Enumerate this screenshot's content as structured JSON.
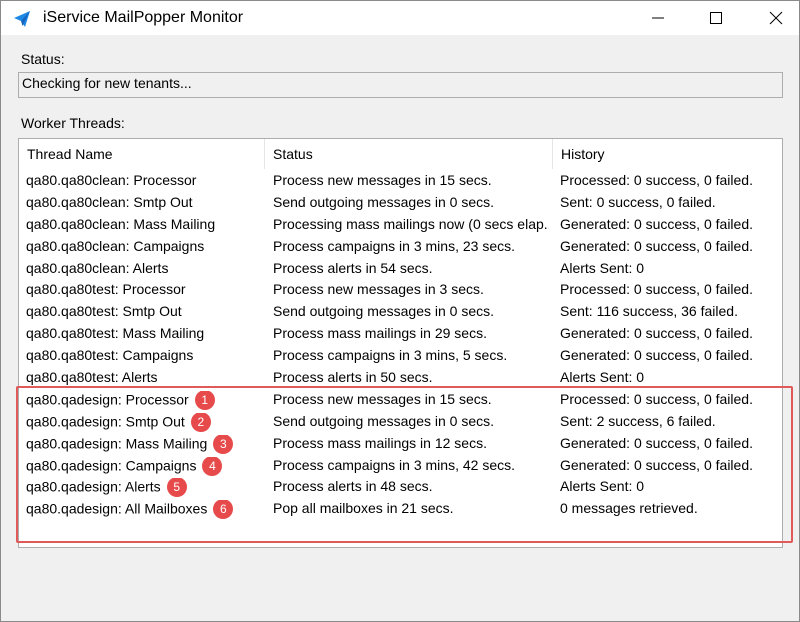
{
  "window": {
    "title": "iService MailPopper Monitor",
    "icon": "paper-plane-icon",
    "controls": [
      "minimize-icon",
      "maximize-icon",
      "close-icon"
    ]
  },
  "status": {
    "label": "Status:",
    "value": "Checking for new tenants..."
  },
  "worker_threads": {
    "label": "Worker Threads:",
    "columns": [
      "Thread Name",
      "Status",
      "History"
    ],
    "rows": [
      {
        "name": "qa80.qa80clean: Processor",
        "status": "Process new messages in 15 secs.",
        "history": "Processed: 0 success, 0 failed.",
        "badge": ""
      },
      {
        "name": "qa80.qa80clean: Smtp Out",
        "status": "Send outgoing messages in 0 secs.",
        "history": "Sent: 0 success, 0 failed.",
        "badge": ""
      },
      {
        "name": "qa80.qa80clean: Mass Mailing",
        "status": "Processing mass mailings now (0 secs elap...",
        "history": "Generated: 0 success, 0 failed.",
        "badge": ""
      },
      {
        "name": "qa80.qa80clean: Campaigns",
        "status": "Process campaigns in 3 mins, 23 secs.",
        "history": "Generated: 0 success, 0 failed.",
        "badge": ""
      },
      {
        "name": "qa80.qa80clean: Alerts",
        "status": "Process alerts in 54 secs.",
        "history": "Alerts Sent: 0",
        "badge": ""
      },
      {
        "name": "qa80.qa80test: Processor",
        "status": "Process new messages in 3 secs.",
        "history": "Processed: 0 success, 0 failed.",
        "badge": ""
      },
      {
        "name": "qa80.qa80test: Smtp Out",
        "status": "Send outgoing messages in 0 secs.",
        "history": "Sent: 116 success, 36 failed.",
        "badge": ""
      },
      {
        "name": "qa80.qa80test: Mass Mailing",
        "status": "Process mass mailings in 29 secs.",
        "history": "Generated: 0 success, 0 failed.",
        "badge": ""
      },
      {
        "name": "qa80.qa80test: Campaigns",
        "status": "Process campaigns in 3 mins, 5 secs.",
        "history": "Generated: 0 success, 0 failed.",
        "badge": ""
      },
      {
        "name": "qa80.qa80test: Alerts",
        "status": "Process alerts in 50 secs.",
        "history": "Alerts Sent: 0",
        "badge": ""
      },
      {
        "name": "qa80.qadesign: Processor",
        "status": "Process new messages in 15 secs.",
        "history": "Processed: 0 success, 0 failed.",
        "badge": "1"
      },
      {
        "name": "qa80.qadesign: Smtp Out",
        "status": "Send outgoing messages in 0 secs.",
        "history": "Sent: 2 success, 6 failed.",
        "badge": "2"
      },
      {
        "name": "qa80.qadesign: Mass Mailing",
        "status": "Process mass mailings in 12 secs.",
        "history": "Generated: 0 success, 0 failed.",
        "badge": "3"
      },
      {
        "name": "qa80.qadesign: Campaigns",
        "status": "Process campaigns in 3 mins, 42 secs.",
        "history": "Generated: 0 success, 0 failed.",
        "badge": "4"
      },
      {
        "name": "qa80.qadesign: Alerts",
        "status": "Process alerts in 48 secs.",
        "history": "Alerts Sent: 0",
        "badge": "5"
      },
      {
        "name": "qa80.qadesign: All Mailboxes",
        "status": "Pop all mailboxes in 21 secs.",
        "history": "0 messages retrieved.",
        "badge": "6"
      }
    ]
  },
  "colors": {
    "highlight": "#e05a5a",
    "badge": "#e74a4a",
    "app_icon": "#1e88e5"
  }
}
